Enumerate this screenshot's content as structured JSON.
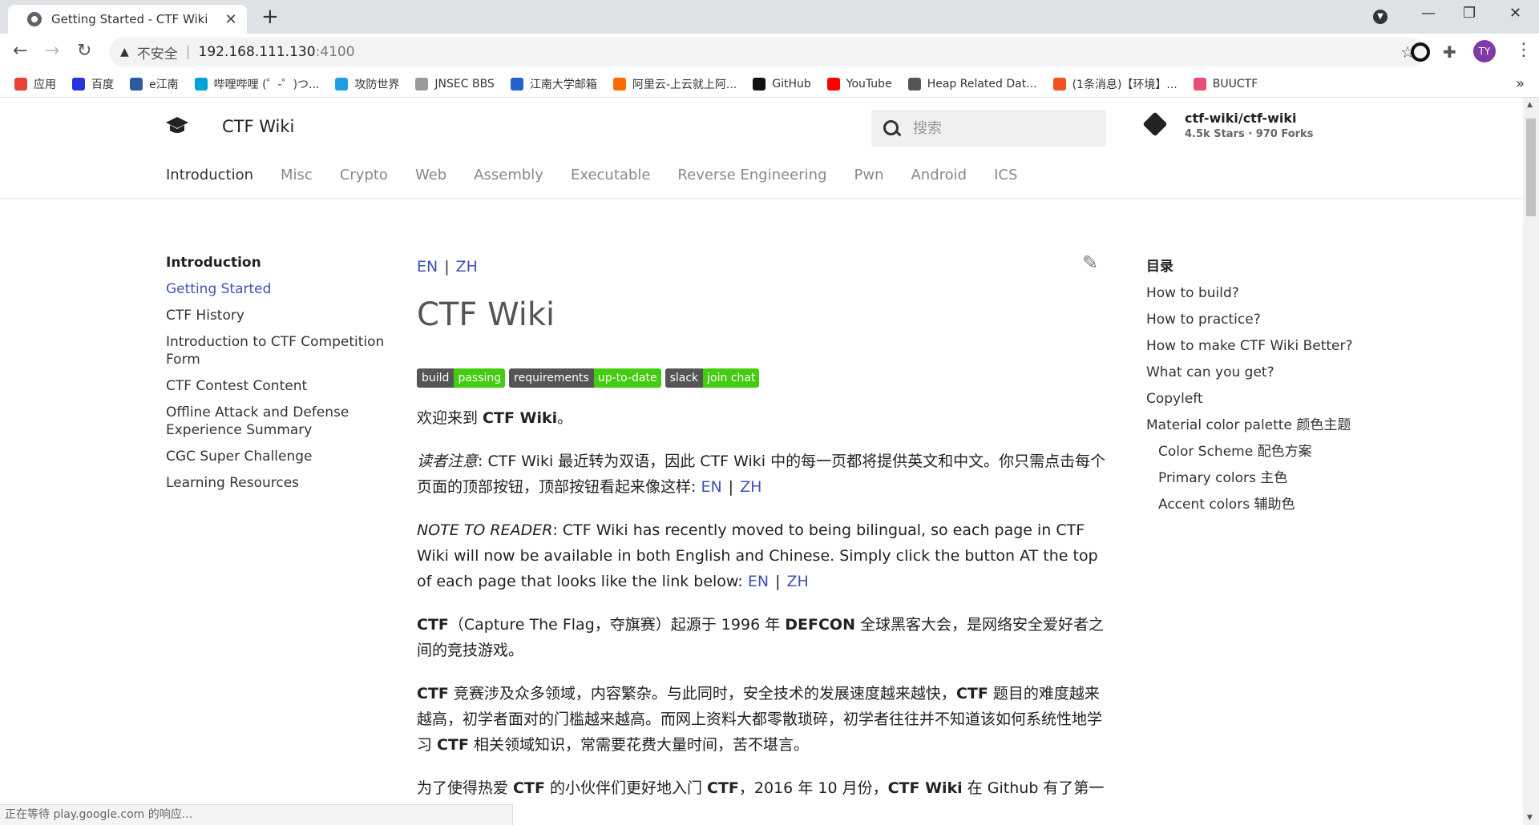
{
  "browser": {
    "tab_title": "Getting Started - CTF Wiki",
    "tab_close": "✕",
    "new_tab": "+",
    "url_warning": "不安全",
    "url_host": "192.168.111.130",
    "url_port": ":4100",
    "avatar_initials": "TY",
    "status_text": "正在等待 play.google.com 的响应..."
  },
  "bookmarks": [
    {
      "label": "应用",
      "color": "#e94235"
    },
    {
      "label": "百度",
      "color": "#2932e1"
    },
    {
      "label": "e江南",
      "color": "#2c5aa0"
    },
    {
      "label": "哔哩哔哩 (゜-゜)つ...",
      "color": "#00a1d6"
    },
    {
      "label": "攻防世界",
      "color": "#1ca0e3"
    },
    {
      "label": "JNSEC BBS",
      "color": "#999999"
    },
    {
      "label": "江南大学邮箱",
      "color": "#1e63d0"
    },
    {
      "label": "阿里云-上云就上阿...",
      "color": "#ff6a00"
    },
    {
      "label": "GitHub",
      "color": "#111111"
    },
    {
      "label": "YouTube",
      "color": "#ff0000"
    },
    {
      "label": "Heap Related Dat...",
      "color": "#555555"
    },
    {
      "label": "(1条消息)【环境】...",
      "color": "#f4511e"
    },
    {
      "label": "BUUCTF",
      "color": "#e94e77"
    }
  ],
  "site": {
    "title": "CTF Wiki",
    "search_placeholder": "搜索",
    "repo_name": "ctf-wiki/ctf-wiki",
    "repo_stats": "4.5k Stars · 970 Forks"
  },
  "tabs": [
    "Introduction",
    "Misc",
    "Crypto",
    "Web",
    "Assembly",
    "Executable",
    "Reverse Engineering",
    "Pwn",
    "Android",
    "ICS"
  ],
  "leftnav": {
    "heading": "Introduction",
    "items": [
      "Getting Started",
      "CTF History",
      "Introduction to CTF Competition Form",
      "CTF Contest Content",
      "Offline Attack and Defense Experience Summary",
      "CGC Super Challenge",
      "Learning Resources"
    ]
  },
  "main": {
    "lang_en": "EN",
    "lang_sep": "|",
    "lang_zh": "ZH",
    "title": "CTF Wiki",
    "badges": [
      {
        "left": "build",
        "right": "passing"
      },
      {
        "left": "requirements",
        "right": "up-to-date"
      },
      {
        "left": "slack",
        "right": "join chat"
      }
    ],
    "p1_a": "欢迎来到 ",
    "p1_b": "CTF Wiki",
    "p1_c": "。",
    "p2_label": "读者注意",
    "p2_text": ":  CTF Wiki 最近转为双语，因此 CTF Wiki 中的每一页都将提供英文和中文。你只需点击每个页面的顶部按钮，顶部按钮看起来像这样: ",
    "p3_label": "NOTE TO READER",
    "p3_text": ": CTF Wiki has recently moved to being bilingual, so each page in CTF Wiki will now be available in both English and Chinese. Simply click the button AT the top of each page that looks like the link below: ",
    "p4_a": "CTF",
    "p4_b": "（Capture The Flag，夺旗赛）起源于 1996 年 ",
    "p4_c": "DEFCON",
    "p4_d": " 全球黑客大会，是网络安全爱好者之间的竞技游戏。",
    "p5_a": "CTF",
    "p5_b": " 竞赛涉及众多领域，内容繁杂。与此同时，安全技术的发展速度越来越快，",
    "p5_c": "CTF",
    "p5_d": " 题目的难度越来越高，初学者面对的门槛越来越高。而网上资料大都零散琐碎，初学者往往并不知道该如何系统性地学习 ",
    "p5_e": "CTF",
    "p5_f": " 相关领域知识，常需要花费大量时间，苦不堪言。",
    "p6_a": "为了使得热爱 ",
    "p6_b": "CTF",
    "p6_c": " 的小伙伴们更好地入门 ",
    "p6_d": "CTF",
    "p6_e": "，2016 年 10 月份，",
    "p6_f": "CTF Wiki",
    "p6_g": " 在 Github 有了第一"
  },
  "toc": {
    "heading": "目录",
    "items": [
      {
        "label": "How to build?",
        "sub": false
      },
      {
        "label": "How to practice?",
        "sub": false
      },
      {
        "label": "How to make CTF Wiki Better?",
        "sub": false
      },
      {
        "label": "What can you get?",
        "sub": false
      },
      {
        "label": "Copyleft",
        "sub": false
      },
      {
        "label": "Material color palette 颜色主题",
        "sub": false
      },
      {
        "label": "Color Scheme 配色方案",
        "sub": true
      },
      {
        "label": "Primary colors 主色",
        "sub": true
      },
      {
        "label": "Accent colors 辅助色",
        "sub": true
      }
    ]
  },
  "colors": {
    "link": "#3f51b5",
    "badge_green": "#44cc11",
    "badge_gray": "#555555"
  }
}
